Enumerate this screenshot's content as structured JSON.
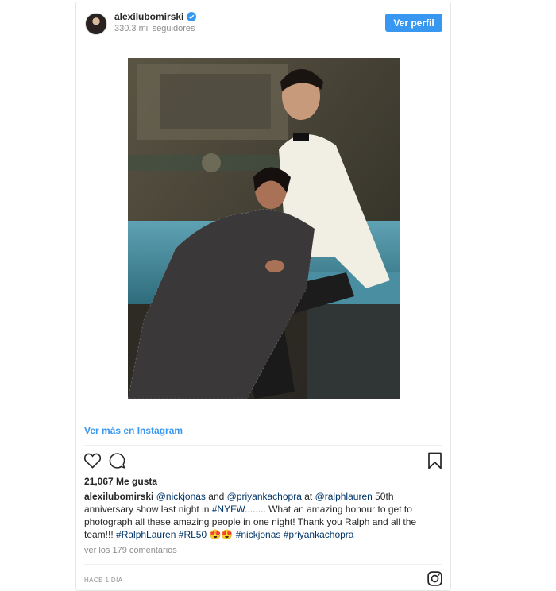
{
  "post": {
    "username": "alexilubomirski",
    "followers": "330.3 mil seguidores",
    "profile_button": "Ver perfil",
    "view_more": "Ver más en Instagram",
    "likes": "21,067 Me gusta",
    "caption": {
      "username": "alexilubomirski",
      "t1": " ",
      "m1": "@nickjonas",
      "t2": " and ",
      "m2": "@priyankachopra",
      "t3": " at ",
      "m3": "@ralphlauren",
      "t4": " 50th anniversary show last night in ",
      "h1": "#NYFW",
      "t5": "........ What an amazing honour to get to photograph all these amazing people in one night! Thank you Ralph and all the team!!! ",
      "h2": "#RalphLauren",
      "t6": " ",
      "h3": "#RL50",
      "t7": " 😍😍 ",
      "m4": "#nickjonas",
      "t8": " ",
      "m5": "#priyankachopra"
    },
    "comments_link": "ver los 179 comentarios",
    "timestamp": "HACE 1 DÍA"
  },
  "icons": [
    "verified-badge-icon",
    "heart-icon",
    "comment-icon",
    "bookmark-icon",
    "instagram-icon"
  ],
  "colors": {
    "accent": "#3897f0",
    "link": "#003569",
    "muted": "#8e8e8e",
    "text": "#262626"
  }
}
